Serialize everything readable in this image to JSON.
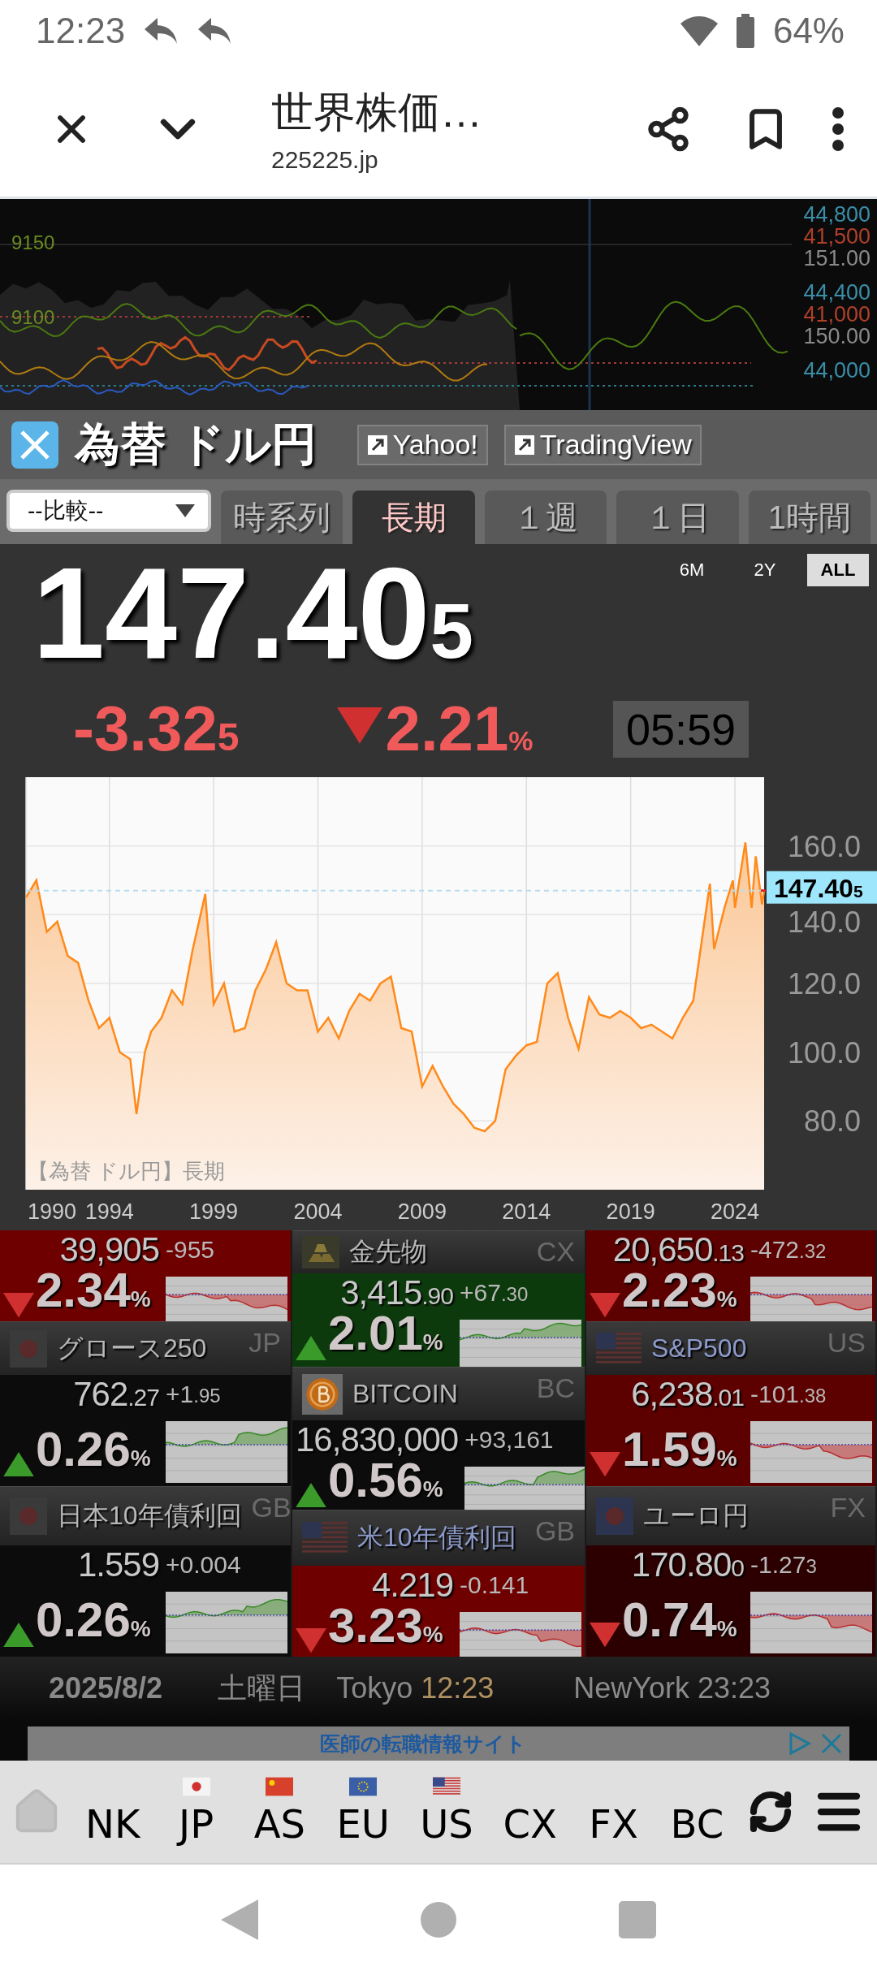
{
  "status_bar": {
    "time": "12:23",
    "battery": "64%"
  },
  "browser_toolbar": {
    "title": "世界株価…",
    "url": "225225.jp"
  },
  "background_chart": {
    "left_labels": [
      "9150",
      "9100"
    ],
    "right_labels": [
      {
        "text": "44,800",
        "color": "#3a8ea8"
      },
      {
        "text": "41,500",
        "color": "#b0402a"
      },
      {
        "text": "151.00",
        "color": "#8a8a8a"
      },
      {
        "text": "44,400",
        "color": "#3a8ea8"
      },
      {
        "text": "41,000",
        "color": "#b0402a"
      },
      {
        "text": "150.00",
        "color": "#8a8a8a"
      },
      {
        "text": "44,000",
        "color": "#3a8ea8"
      }
    ]
  },
  "panel": {
    "title": "為替 ドル円",
    "links": [
      "Yahoo!",
      "TradingView"
    ],
    "compare_select": {
      "placeholder": "--比較--"
    },
    "tabs": [
      {
        "label": "時系列",
        "selected": false
      },
      {
        "label": "長期",
        "selected": true
      },
      {
        "label": "１週",
        "selected": false
      },
      {
        "label": "１日",
        "selected": false
      },
      {
        "label": "1時間",
        "selected": false
      }
    ]
  },
  "quote": {
    "price": {
      "main": "147.40",
      "small": "5"
    },
    "ranges": [
      {
        "label": "6M",
        "selected": false
      },
      {
        "label": "2Y",
        "selected": false
      },
      {
        "label": "ALL",
        "selected": true
      }
    ],
    "change": {
      "main": "-3.32",
      "small": "5"
    },
    "percent": {
      "main": "2.21",
      "unit": "%"
    },
    "falling": true,
    "time": "05:59"
  },
  "chart": {
    "price_tag": {
      "main": "147.40",
      "small": "5"
    },
    "chart_data": {
      "type": "area",
      "title": "【為替 ドル円】長期",
      "grid": true,
      "x": [
        1990,
        1990.5,
        1991,
        1991.5,
        1992,
        1992.5,
        1993,
        1993.5,
        1994,
        1994.5,
        1995,
        1995.3,
        1995.7,
        1996,
        1996.5,
        1997,
        1997.5,
        1998,
        1998.6,
        1999,
        1999.5,
        2000,
        2000.5,
        2001,
        2001.5,
        2002,
        2002.5,
        2003,
        2003.5,
        2004,
        2004.5,
        2005,
        2005.5,
        2006,
        2006.5,
        2007,
        2007.5,
        2008,
        2008.5,
        2009,
        2009.5,
        2010,
        2010.5,
        2011,
        2011.5,
        2012,
        2012.5,
        2013,
        2013.5,
        2014,
        2014.5,
        2015,
        2015.5,
        2016,
        2016.5,
        2017,
        2017.5,
        2018,
        2018.5,
        2019,
        2019.5,
        2020,
        2020.5,
        2021,
        2021.5,
        2022,
        2022.8,
        2023,
        2023.5,
        2023.9,
        2024,
        2024.5,
        2024.8,
        2025,
        2025.3,
        2025.4
      ],
      "series": [
        {
          "color": "#ff8a1a",
          "values": [
            145,
            150,
            135,
            138,
            128,
            126,
            115,
            107,
            110,
            100,
            98,
            82,
            100,
            106,
            110,
            118,
            114,
            130,
            146,
            114,
            120,
            106,
            107,
            118,
            124,
            132,
            120,
            118,
            118,
            106,
            110,
            104,
            112,
            117,
            115,
            120,
            122,
            107,
            106,
            90,
            96,
            90,
            85,
            82,
            78,
            77,
            80,
            95,
            99,
            102,
            103,
            120,
            123,
            110,
            101,
            116,
            111,
            110,
            112,
            110,
            107,
            108,
            106,
            104,
            110,
            115,
            149,
            130,
            142,
            150,
            142,
            161,
            142,
            157,
            143,
            147
          ]
        }
      ],
      "xlim": [
        1990,
        2025.4
      ],
      "ylim": [
        60,
        180
      ],
      "xticks": [
        1990,
        1994,
        1999,
        2004,
        2009,
        2014,
        2019,
        2024
      ],
      "yticks": [
        {
          "value": 80,
          "label": "80.0"
        },
        {
          "value": 100,
          "label": "100.0"
        },
        {
          "value": 120,
          "label": "120.0"
        },
        {
          "value": 140,
          "label": "140.0"
        },
        {
          "value": 160,
          "label": "160.0"
        }
      ]
    }
  },
  "tiles": [
    [
      {
        "value": {
          "main": "39,905"
        },
        "change": {
          "main": "-955"
        },
        "percent": {
          "main": "2.34",
          "unit": "%"
        },
        "rising": false,
        "color": "#6e0000"
      },
      {
        "name": "グロース250",
        "code": "JP",
        "kind": "jp",
        "highlighted": false,
        "value": {
          "main": "762",
          "small": ".27"
        },
        "change": {
          "main": "+1",
          "small": ".95"
        },
        "percent": {
          "main": "0.26",
          "unit": "%"
        },
        "rising": true,
        "color": "#0c0c0c"
      },
      {
        "name": "日本10年債利回",
        "code": "GB",
        "kind": "jp",
        "highlighted": false,
        "value": {
          "main": "1.559"
        },
        "change": {
          "main": "+0.004"
        },
        "percent": {
          "main": "0.26",
          "unit": "%"
        },
        "rising": true,
        "color": "#0c0c0c"
      }
    ],
    [
      {
        "name": "金先物",
        "code": "CX",
        "kind": "gold",
        "highlighted": false,
        "value": {
          "main": "3,415",
          "small": ".90"
        },
        "change": {
          "main": "+67",
          "small": ".30"
        },
        "percent": {
          "main": "2.01",
          "unit": "%"
        },
        "rising": true,
        "color": "#0d3a0d"
      },
      {
        "name": "BITCOIN",
        "code": "BC",
        "kind": "bitcoin",
        "highlighted": false,
        "value": {
          "main": "16,830,000"
        },
        "change": {
          "main": "+93,161"
        },
        "percent": {
          "main": "0.56",
          "unit": "%"
        },
        "rising": true,
        "color": "#0c0c0c"
      },
      {
        "name": "米10年債利回",
        "code": "GB",
        "kind": "us",
        "highlighted": true,
        "value": {
          "main": "4.219"
        },
        "change": {
          "main": "-0.141"
        },
        "percent": {
          "main": "3.23",
          "unit": "%"
        },
        "rising": false,
        "color": "#6e0000"
      }
    ],
    [
      {
        "value": {
          "main": "20,650",
          "small": ".13"
        },
        "change": {
          "main": "-472",
          "small": ".32"
        },
        "percent": {
          "main": "2.23",
          "unit": "%"
        },
        "rising": false,
        "color": "#5c0000"
      },
      {
        "name": "S&P500",
        "code": "US",
        "kind": "us",
        "highlighted": true,
        "value": {
          "main": "6,238",
          "small": ".01"
        },
        "change": {
          "main": "-101",
          "small": ".38"
        },
        "percent": {
          "main": "1.59",
          "unit": "%"
        },
        "rising": false,
        "color": "#5c0000"
      },
      {
        "name": "ユーロ円",
        "code": "FX",
        "kind": "eu",
        "highlighted": false,
        "value": {
          "main": "170.80",
          "small": "0"
        },
        "change": {
          "main": "-1.27",
          "small": "3"
        },
        "percent": {
          "main": "0.74",
          "unit": "%"
        },
        "rising": false,
        "color": "#2c0000"
      }
    ]
  ],
  "date_bar": {
    "date": "2025/8/2",
    "weekday": "土曜日",
    "cities": [
      {
        "name": "Tokyo",
        "time": "12:23",
        "color": "#b09060"
      },
      {
        "name": "NewYork",
        "time": "23:23",
        "color": "#8a8a8a"
      }
    ]
  },
  "ad": {
    "text": "医師の転職情報サイト"
  },
  "bottom_nav": [
    {
      "label": "NK"
    },
    {
      "label": "JP",
      "kind": "jp"
    },
    {
      "label": "AS",
      "kind": "cn"
    },
    {
      "label": "EU",
      "kind": "eu"
    },
    {
      "label": "US",
      "kind": "us"
    },
    {
      "label": "CX"
    },
    {
      "label": "FX"
    },
    {
      "label": "BC"
    }
  ]
}
